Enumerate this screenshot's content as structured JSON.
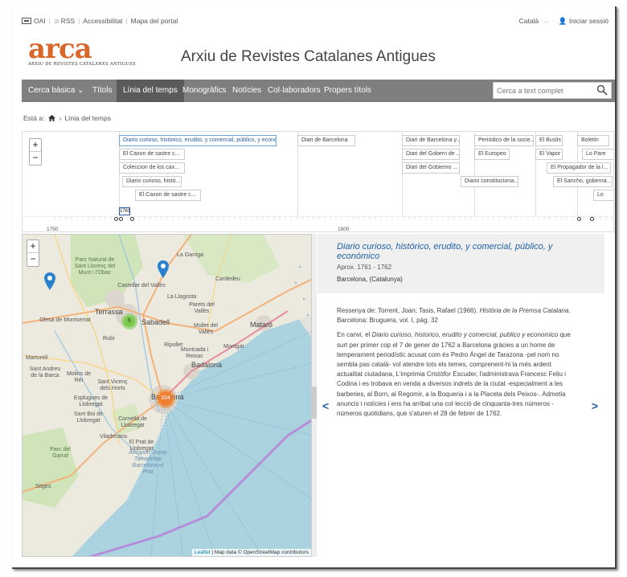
{
  "topbar": {
    "links": [
      "OAI",
      "RSS",
      "Accessibilitat",
      "Mapa del portal"
    ],
    "language": "Català",
    "login": "Iniciar sessió"
  },
  "logo": {
    "word": "arca",
    "subtitle": "ARXIU DE REVISTES CATALANES ANTIGUES"
  },
  "site_title": "Arxiu de Revistes Catalanes Antigues",
  "nav": {
    "items": [
      "Cerca bàsica",
      "Títols",
      "Línia del temps",
      "Monogràfics",
      "Notícies",
      "Col·laboradors",
      "Propers títols"
    ],
    "active": "Línia del temps",
    "search_placeholder": "Cerca a text complet"
  },
  "breadcrumb": {
    "prefix": "Està a:",
    "current": "Línia del temps"
  },
  "timeline": {
    "events": [
      "Diario curioso, histórico, erudito, y comercial, público, y económico",
      "El Caxon de sastre c...",
      "Coleccion de los cax...",
      "Diario curioso, histó...",
      "El Caxon de sastre c...",
      "Diari de Barcelona",
      "Diari de Barcelona y...",
      "Diari del Gobern de ...",
      "Diari del Gobierno ...",
      "Periódico de la socie...",
      "El Europeo",
      "Diario constituciona...",
      "El Buslis",
      "El Vapor",
      "El Propagador de la l...",
      "El Sancho, goberna...",
      "Boletín",
      "Lo Pare",
      "Lo"
    ],
    "axis_labels": [
      "1750",
      "1761",
      "1800"
    ],
    "zoom_in": "+",
    "zoom_out": "−"
  },
  "map": {
    "zoom_in": "+",
    "zoom_out": "−",
    "labels": [
      "La Garriga",
      "Parc Natural de Sant Llorenç del Munt i l'Obac",
      "Cardedeu",
      "Castellar del Vallès",
      "Terrassa",
      "Sabadell",
      "Parets del Vallès",
      "Mollet del Vallès",
      "Olesa de Montserrat",
      "Mataró",
      "Montcada i Reixac",
      "Badalona",
      "Barcelona",
      "Sant Vicenç dels Horts",
      "Cornellà de Llobregat",
      "Viladecans",
      "El Prat de Llobregat",
      "Parc del Garraf",
      "Sitges",
      "Aeroport Josep Tarradellas Barcelona el Prat",
      "La Llagosta",
      "Ripollet",
      "Martorell",
      "Sant Andreu de la Barca",
      "Molins de Rei",
      "Esplugues de Llobregat",
      "Sant Boi de Llobregat",
      "Montgat",
      "Rubí"
    ],
    "cluster_green": "6",
    "cluster_orange": "334",
    "attribution_leaflet": "Leaflet",
    "attribution_text": "| Map data © OpenStreetMap contributors"
  },
  "detail": {
    "title": "Diario curioso, histórico, erudito, y comercial, público, y económico",
    "date": "Aprox. 1761 - 1762",
    "place": "Barcelona, (Catalunya)",
    "review_prefix": "Ressenya de: Torrent, Joan; Tasis, Rafael (1966). ",
    "review_book": "Història de la Premsa Catalana",
    "review_suffix": ". Barcelona: Bruguera, vol. I, pàg. 32",
    "body_1": "En canvi, el ",
    "body_title": "Diario curioso, historico, erudito y comercial, publico y economico",
    "body_2": " que surt per primer cop el 7 de gener de 1762 a Barcelona gràcies a un home de temperament periodístic acusat com és Pedro Ángel de Tarazona -pel nom no sembla pas català- vol atendre tots els temes, comprenent-hi la més ardent actualitat ciutadana, L'imprimia Cristòfor Escuder, l'administrava Francesc Feliu i Codina i es trobava en venda a diversos indrets de la ciutat -especialment a les barberies, al Born, al Regomir, a la Boqueria i a la Placeta dels Peixos-. Admetia anuncis i notícies i ens ha arribat una col·lecció de cinquanta-tres números -números quotidians, que s'aturen el 28 de febrer de 1762.",
    "prev": "<",
    "next": ">"
  },
  "colors": {
    "accent": "#d9662a",
    "link": "#1e5fa6",
    "nav": "#7f7f7f",
    "nav_active": "#5a5a5a"
  }
}
